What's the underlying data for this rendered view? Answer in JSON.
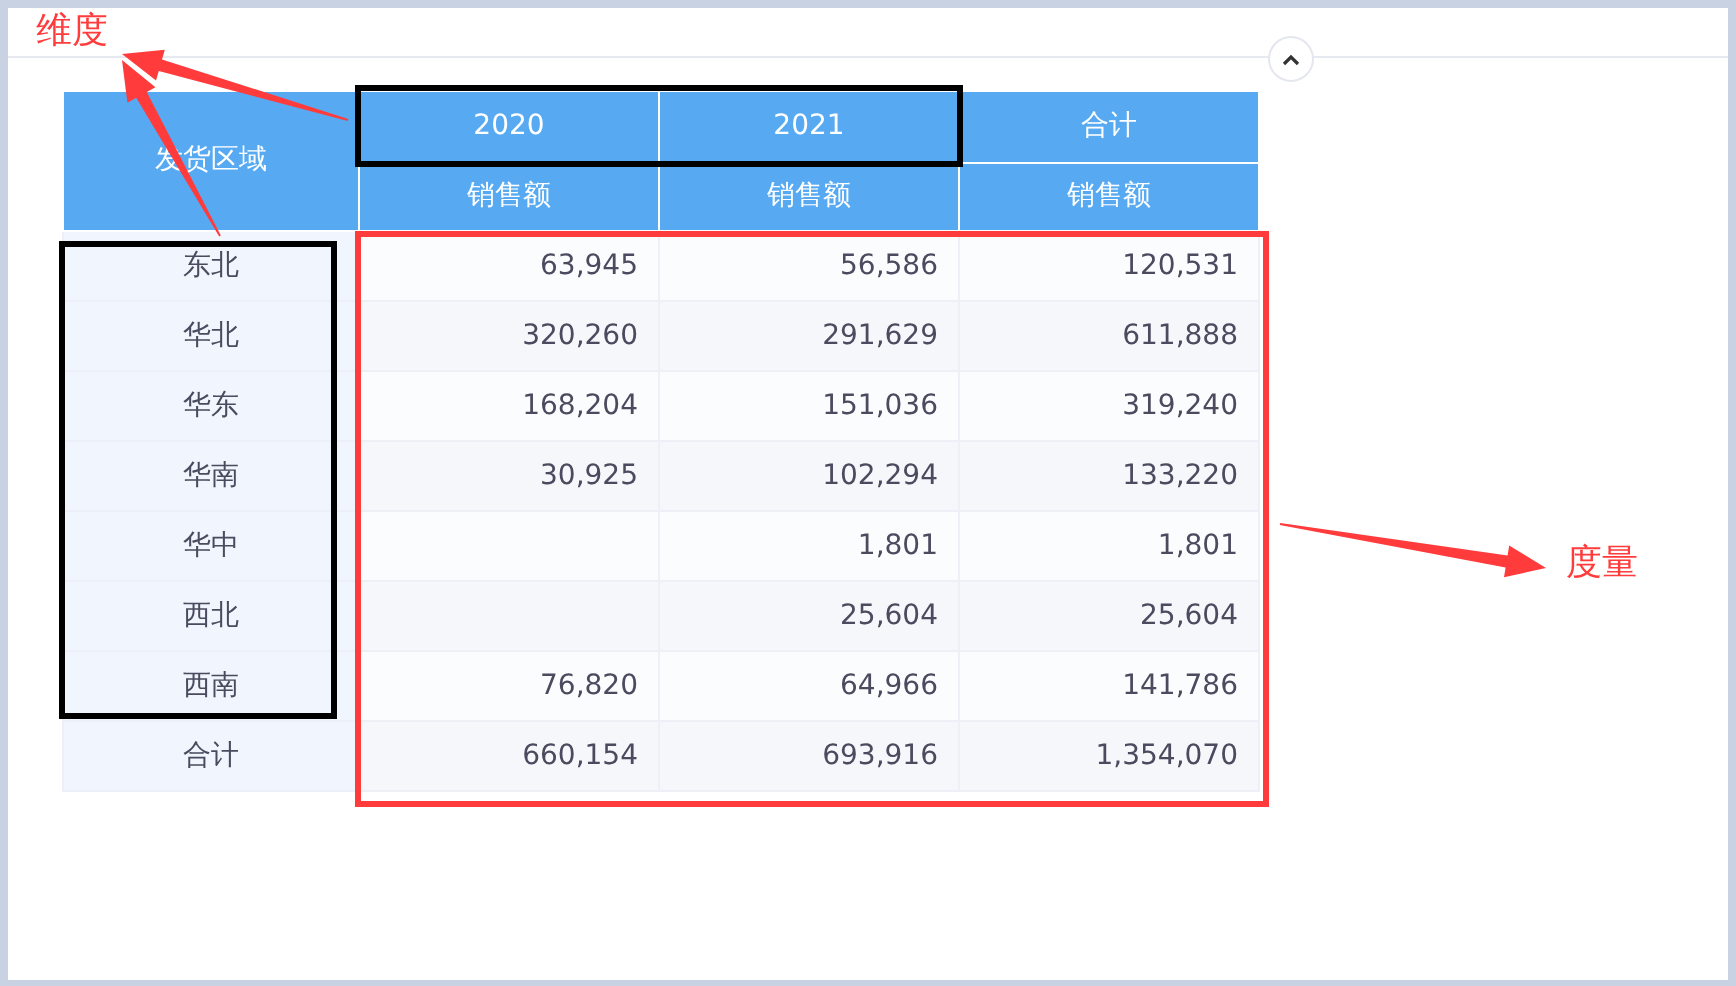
{
  "table": {
    "corner_header": "发货区域",
    "column_headers": [
      "2020",
      "2021",
      "合计"
    ],
    "measure_headers": [
      "销售额",
      "销售额",
      "销售额"
    ],
    "rows": [
      {
        "region": "东北",
        "year_2020": "63,945",
        "year_2021": "56,586",
        "total": "120,531"
      },
      {
        "region": "华北",
        "year_2020": "320,260",
        "year_2021": "291,629",
        "total": "611,888"
      },
      {
        "region": "华东",
        "year_2020": "168,204",
        "year_2021": "151,036",
        "total": "319,240"
      },
      {
        "region": "华南",
        "year_2020": "30,925",
        "year_2021": "102,294",
        "total": "133,220"
      },
      {
        "region": "华中",
        "year_2021": "1,801",
        "total": "1,801"
      },
      {
        "region": "西北",
        "year_2021": "25,604",
        "total": "25,604"
      },
      {
        "region": "西南",
        "year_2020": "76,820",
        "year_2021": "64,966",
        "total": "141,786"
      }
    ],
    "total_row": {
      "region": "合计",
      "year_2020": "660,154",
      "year_2021": "693,916",
      "total": "1,354,070"
    }
  },
  "annotations": [
    {
      "text": "维度",
      "kind": "dimension"
    },
    {
      "text": "度量",
      "kind": "measure"
    }
  ]
}
